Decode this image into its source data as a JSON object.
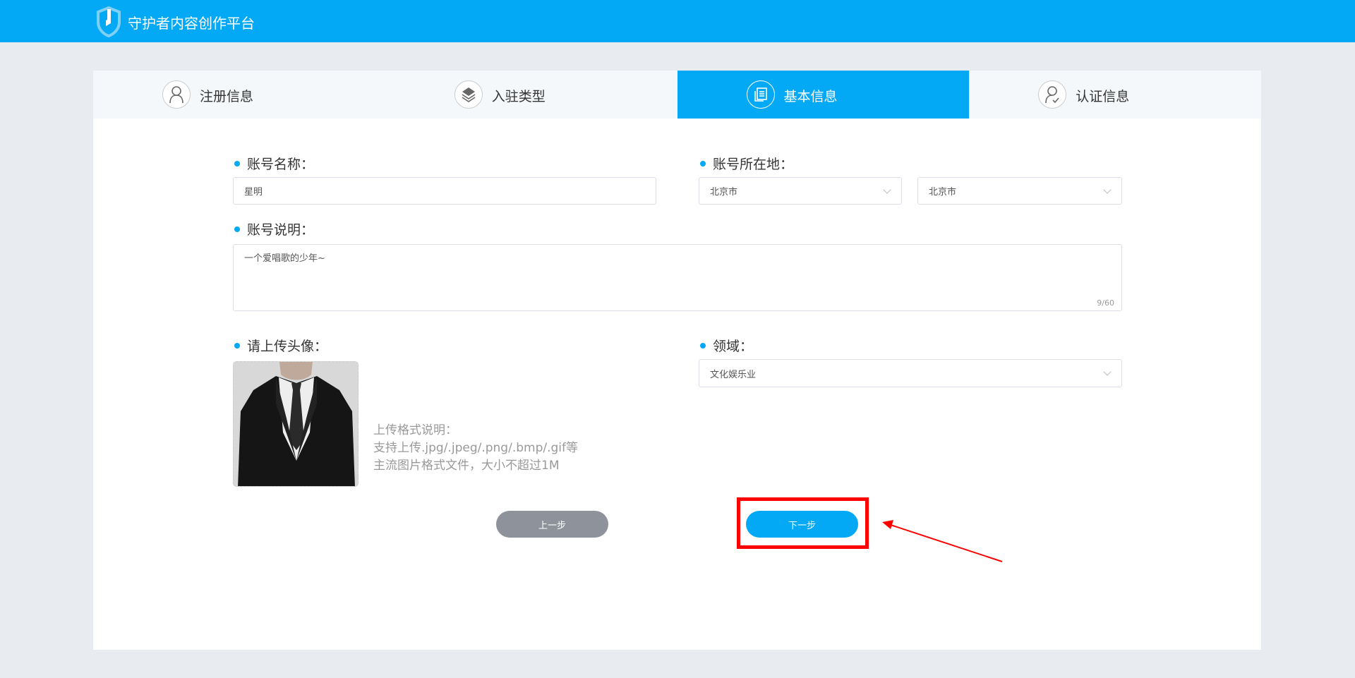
{
  "header": {
    "title": "守护者内容创作平台"
  },
  "steps": [
    {
      "label": "注册信息",
      "icon": "user-icon",
      "active": false
    },
    {
      "label": "入驻类型",
      "icon": "layers-icon",
      "active": false
    },
    {
      "label": "基本信息",
      "icon": "document-icon",
      "active": true
    },
    {
      "label": "认证信息",
      "icon": "user-check-icon",
      "active": false
    }
  ],
  "form": {
    "account_name": {
      "label": "账号名称：",
      "value": "星明"
    },
    "location": {
      "label": "账号所在地：",
      "province": "北京市",
      "city": "北京市"
    },
    "description": {
      "label": "账号说明：",
      "value": "一个爱唱歌的少年~",
      "counter": "9/60"
    },
    "avatar": {
      "label": "请上传头像：",
      "hint": [
        "上传格式说明：",
        "支持上传.jpg/.jpeg/.png/.bmp/.gif等",
        "主流图片格式文件，大小不超过1M"
      ]
    },
    "field": {
      "label": "领域：",
      "value": "文化娱乐业"
    }
  },
  "buttons": {
    "prev": "上一步",
    "next": "下一步"
  },
  "colors": {
    "primary": "#03a9f4",
    "prev_button": "#8e939b",
    "highlight": "#ff0000"
  }
}
